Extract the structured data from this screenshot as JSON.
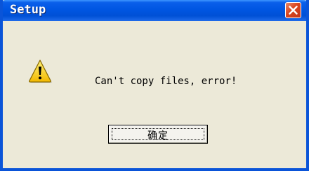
{
  "window": {
    "title": "Setup",
    "close_icon": "close-x-icon"
  },
  "dialog": {
    "icon": "warning-icon",
    "message": "Can't copy files, error!",
    "ok_label": "确定"
  },
  "colors": {
    "titlebar": "#0054E3",
    "body": "#ECE9D8",
    "close_button": "#D9451D",
    "warning": "#FFD800"
  }
}
